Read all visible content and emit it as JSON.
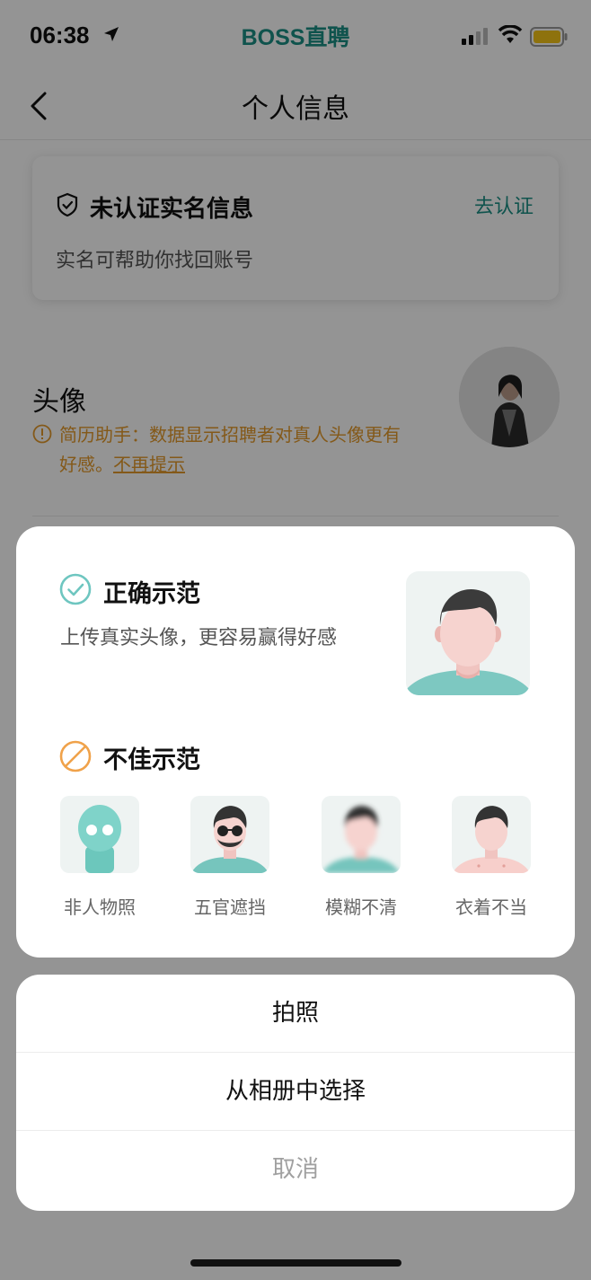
{
  "status_bar": {
    "time": "06:38",
    "brand": "BOSS直聘"
  },
  "nav": {
    "title": "个人信息"
  },
  "verify_card": {
    "title": "未认证实名信息",
    "action": "去认证",
    "subtitle": "实名可帮助你找回账号"
  },
  "avatar_section": {
    "label": "头像",
    "tip": "简历助手：数据显示招聘者对真人头像更有好感。",
    "tip_link": "不再提示"
  },
  "example_sheet": {
    "good_title": "正确示范",
    "good_subtitle": "上传真实头像，更容易赢得好感",
    "bad_title": "不佳示范",
    "bad_examples": [
      {
        "label": "非人物照"
      },
      {
        "label": "五官遮挡"
      },
      {
        "label": "模糊不清"
      },
      {
        "label": "衣着不当"
      }
    ]
  },
  "action_sheet": {
    "items": [
      "拍照",
      "从相册中选择"
    ],
    "cancel": "取消"
  },
  "colors": {
    "accent": "#1b8f85",
    "good": "#6ec6c0",
    "warning": "#e39a2b",
    "overlay": "rgba(0,0,0,0.42)"
  }
}
